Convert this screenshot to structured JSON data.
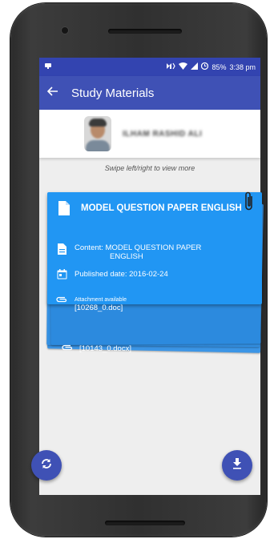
{
  "status_bar": {
    "battery": "85%",
    "time": "3:38 pm"
  },
  "app_bar": {
    "title": "Study Materials"
  },
  "profile": {
    "name": "ILHAM RASHID ALI"
  },
  "hint": "Swipe left/right to view more",
  "card": {
    "title": "MODEL QUESTION PAPER ENGLISH",
    "content_line1": "Content: MODEL QUESTION PAPER",
    "content_line2": "ENGLISH",
    "published": "Published date: 2016-02-24",
    "attachment_label": "Attachment available",
    "attachment_file": "[10268_0.doc]",
    "back_attachment_file": "[10143_0.docx]"
  },
  "colors": {
    "primary": "#3f51b5",
    "status_bar": "#3344b0",
    "card": "#2196f3"
  },
  "icons": {
    "refresh": "refresh-icon",
    "download": "download-icon",
    "attachment": "paperclip-icon"
  }
}
